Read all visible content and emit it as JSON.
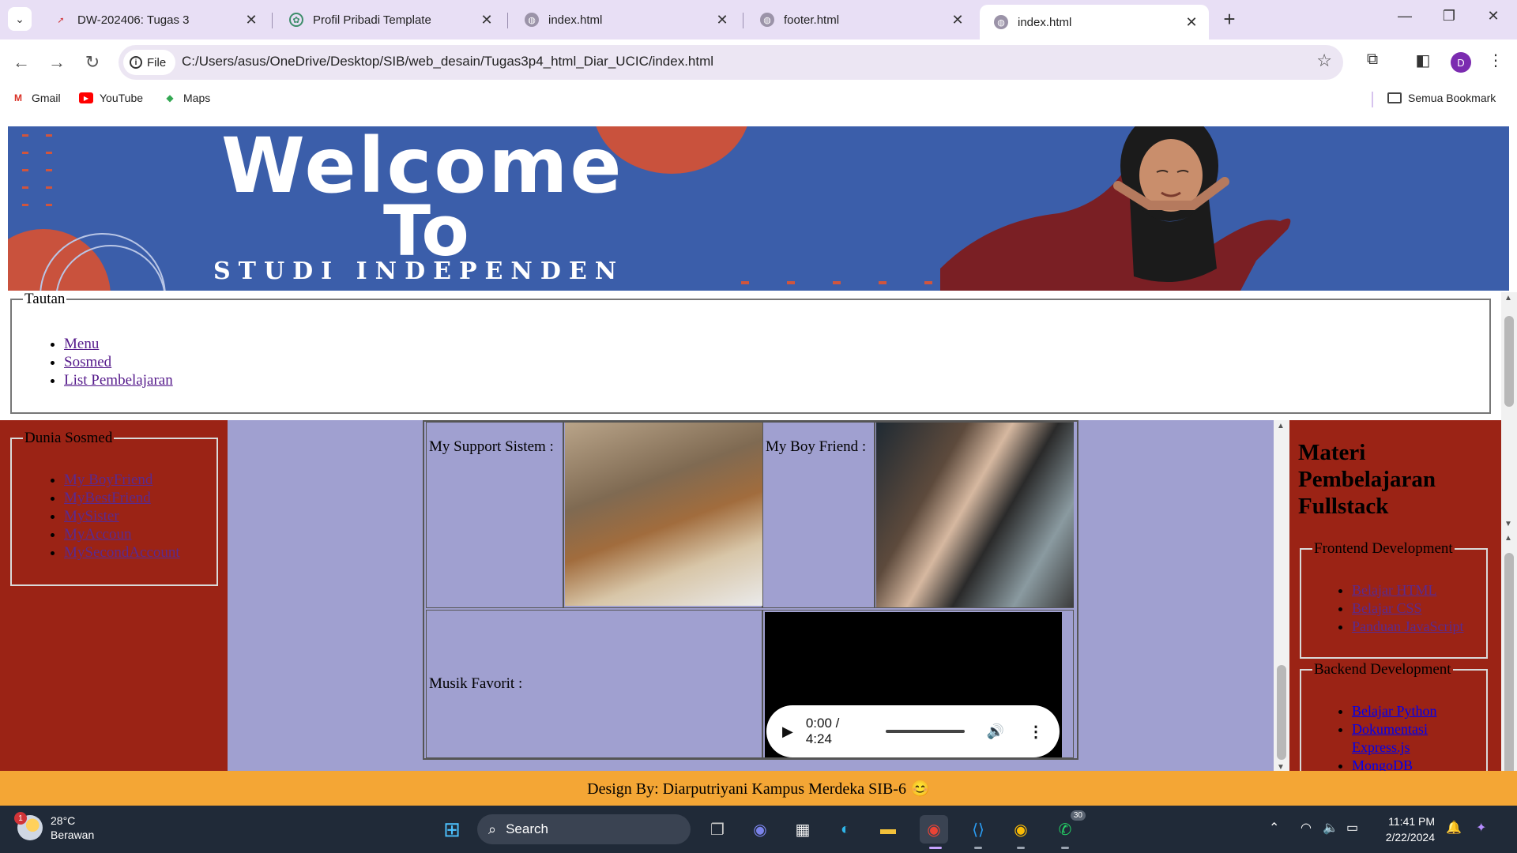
{
  "browser": {
    "tabs": [
      {
        "title": "DW-202406: Tugas 3",
        "active": false
      },
      {
        "title": "Profil Pribadi Template",
        "active": false
      },
      {
        "title": "index.html",
        "active": false
      },
      {
        "title": "footer.html",
        "active": false
      },
      {
        "title": "index.html",
        "active": true
      }
    ],
    "address": {
      "scheme_label": "File",
      "url": "C:/Users/asus/OneDrive/Desktop/SIB/web_desain/Tugas3p4_html_Diar_UCIC/index.html"
    },
    "profile_initial": "D",
    "bookmarks": [
      {
        "label": "Gmail",
        "icon": "gmail-icon"
      },
      {
        "label": "YouTube",
        "icon": "youtube-icon"
      },
      {
        "label": "Maps",
        "icon": "maps-icon"
      }
    ],
    "all_bookmarks_label": "Semua Bookmark"
  },
  "page": {
    "banner": {
      "line1": "Welcome",
      "line2": "To",
      "line3": "STUDI INDEPENDEN"
    },
    "tautan": {
      "legend": "Tautan",
      "links": [
        "Menu",
        "Sosmed",
        "List Pembelajaran"
      ]
    },
    "sosmed": {
      "legend": "Dunia Sosmed",
      "links": [
        "My BoyFriend",
        "MyBestFriend",
        "MySister",
        "MyAccoun",
        "MySecondAccount"
      ]
    },
    "table": {
      "support_label": "My Support Sistem :",
      "boyfriend_label": "My Boy Friend :",
      "music_label": "Musik Favorit :",
      "audio_time": "0:00 / 4:24"
    },
    "materi": {
      "title": "Materi Pembelajaran Fullstack",
      "frontend": {
        "legend": "Frontend Development",
        "links": [
          "Belajar HTML",
          "Belajar CSS",
          "Panduan JavaScript"
        ]
      },
      "backend": {
        "legend": "Backend Development",
        "links": [
          "Belajar Python",
          "Dokumentasi Express.js",
          "MongoDB"
        ]
      }
    },
    "footer": "Design By: Diarputriyani Kampus Merdeka SIB-6 😊"
  },
  "taskbar": {
    "weather": {
      "temp": "28°C",
      "condition": "Berawan",
      "badge": "1"
    },
    "search_label": "Search",
    "whatsapp_badge": "30",
    "time": "11:41 PM",
    "date": "2/22/2024"
  },
  "colors": {
    "banner_blue": "#3b5eaa",
    "panel_red": "#9b2315",
    "center_lavender": "#a0a0d0",
    "footer_orange": "#f4a635",
    "tab_strip": "#e8dff5"
  }
}
